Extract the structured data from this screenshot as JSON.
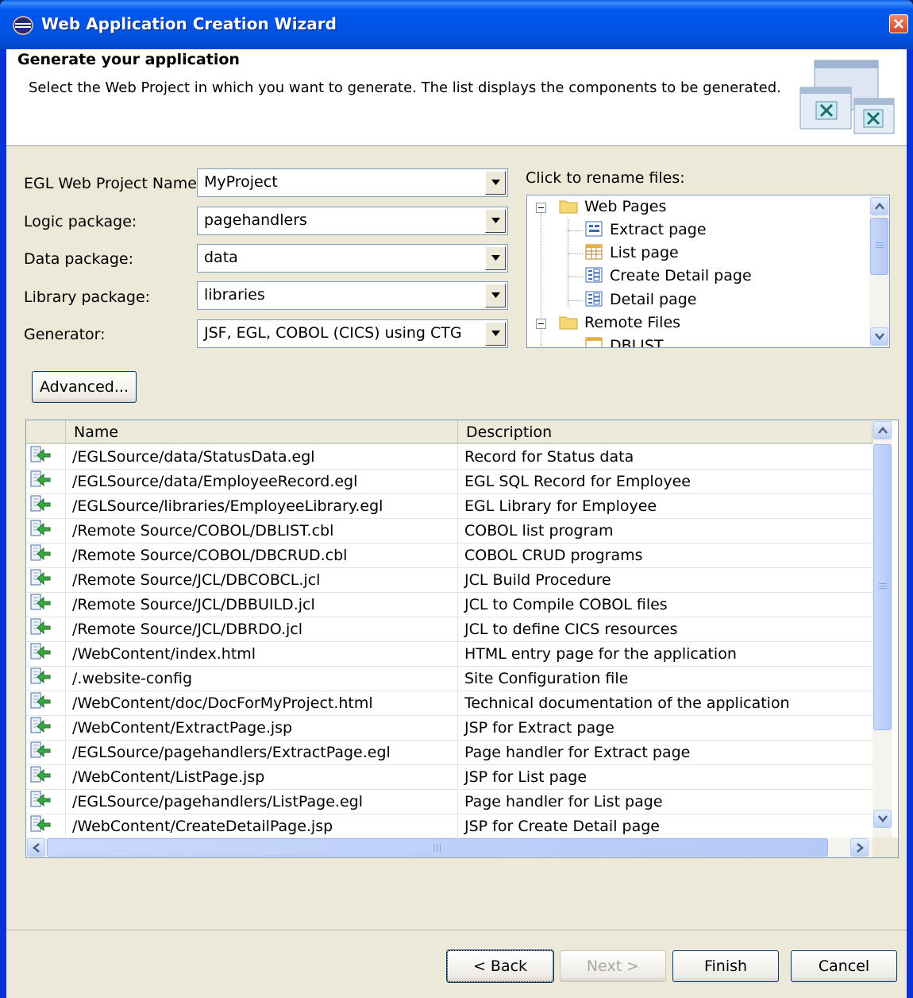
{
  "window": {
    "title": "Web Application Creation Wizard"
  },
  "banner": {
    "title": "Generate your application",
    "description": "Select the Web Project in which you want to generate. The list displays the components to be generated."
  },
  "form": {
    "project_label": "EGL Web Project Name:",
    "project_value": "MyProject",
    "logic_label": "Logic package:",
    "logic_value": "pagehandlers",
    "data_label": "Data package:",
    "data_value": "data",
    "library_label": "Library package:",
    "library_value": "libraries",
    "generator_label": "Generator:",
    "generator_value": "JSF, EGL, COBOL (CICS) using CTG"
  },
  "tree": {
    "label": "Click to rename files:",
    "folder_web": "Web Pages",
    "items_web": [
      "Extract page",
      "List page",
      "Create Detail page",
      "Detail page"
    ],
    "folder_remote": "Remote Files",
    "partial_item": "DBLIST"
  },
  "advanced_button": "Advanced...",
  "table": {
    "headers": {
      "name": "Name",
      "description": "Description"
    },
    "rows": [
      {
        "name": "/EGLSource/data/StatusData.egl",
        "description": "Record for Status data"
      },
      {
        "name": "/EGLSource/data/EmployeeRecord.egl",
        "description": "EGL SQL Record for Employee"
      },
      {
        "name": "/EGLSource/libraries/EmployeeLibrary.egl",
        "description": "EGL Library for Employee"
      },
      {
        "name": "/Remote Source/COBOL/DBLIST.cbl",
        "description": "COBOL list program"
      },
      {
        "name": "/Remote Source/COBOL/DBCRUD.cbl",
        "description": "COBOL CRUD programs"
      },
      {
        "name": "/Remote Source/JCL/DBCOBCL.jcl",
        "description": "JCL Build Procedure"
      },
      {
        "name": "/Remote Source/JCL/DBBUILD.jcl",
        "description": "JCL to Compile COBOL files"
      },
      {
        "name": "/Remote Source/JCL/DBRDO.jcl",
        "description": "JCL to define CICS resources"
      },
      {
        "name": "/WebContent/index.html",
        "description": "HTML entry page for the application"
      },
      {
        "name": "/.website-config",
        "description": "Site Configuration file"
      },
      {
        "name": "/WebContent/doc/DocForMyProject.html",
        "description": "Technical documentation of the application"
      },
      {
        "name": "/WebContent/ExtractPage.jsp",
        "description": "JSP for Extract page"
      },
      {
        "name": "/EGLSource/pagehandlers/ExtractPage.egl",
        "description": "Page handler for Extract page"
      },
      {
        "name": "/WebContent/ListPage.jsp",
        "description": "JSP for List page"
      },
      {
        "name": "/EGLSource/pagehandlers/ListPage.egl",
        "description": "Page handler for List page"
      },
      {
        "name": "/WebContent/CreateDetailPage.jsp",
        "description": "JSP for Create Detail page"
      }
    ]
  },
  "buttons": {
    "back": "< Back",
    "next": "Next >",
    "finish": "Finish",
    "cancel": "Cancel"
  },
  "colors": {
    "titlebar": "#0054e3",
    "dialog_bg": "#ece9d8",
    "scroll_thumb": "#c1d3fb",
    "accent_green": "#3aa844"
  }
}
